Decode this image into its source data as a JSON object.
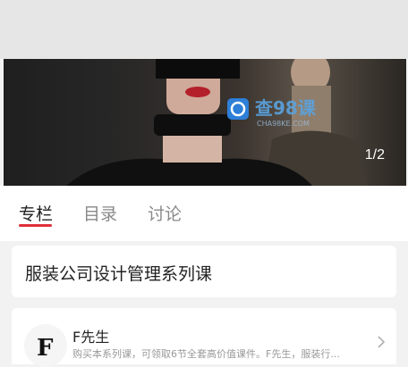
{
  "banner": {
    "counter": "1/2",
    "watermark_text": "查98课",
    "watermark_sub": "CHA98KE.COM"
  },
  "tabs": [
    {
      "label": "专栏",
      "active": true
    },
    {
      "label": "目录",
      "active": false
    },
    {
      "label": "讨论",
      "active": false
    }
  ],
  "course": {
    "title": "服装公司设计管理系列课"
  },
  "author": {
    "avatar_letter": "F",
    "name": "F先生",
    "description": "购买本系列课，可领取6节全套高价值课件。F先生，服装行..."
  },
  "colors": {
    "accent": "#e02e3a",
    "background": "#f2f2f2",
    "card": "#ffffff"
  },
  "icons": {
    "watermark": "watermark-logo-icon",
    "disclosure": "chevron-right-icon"
  }
}
